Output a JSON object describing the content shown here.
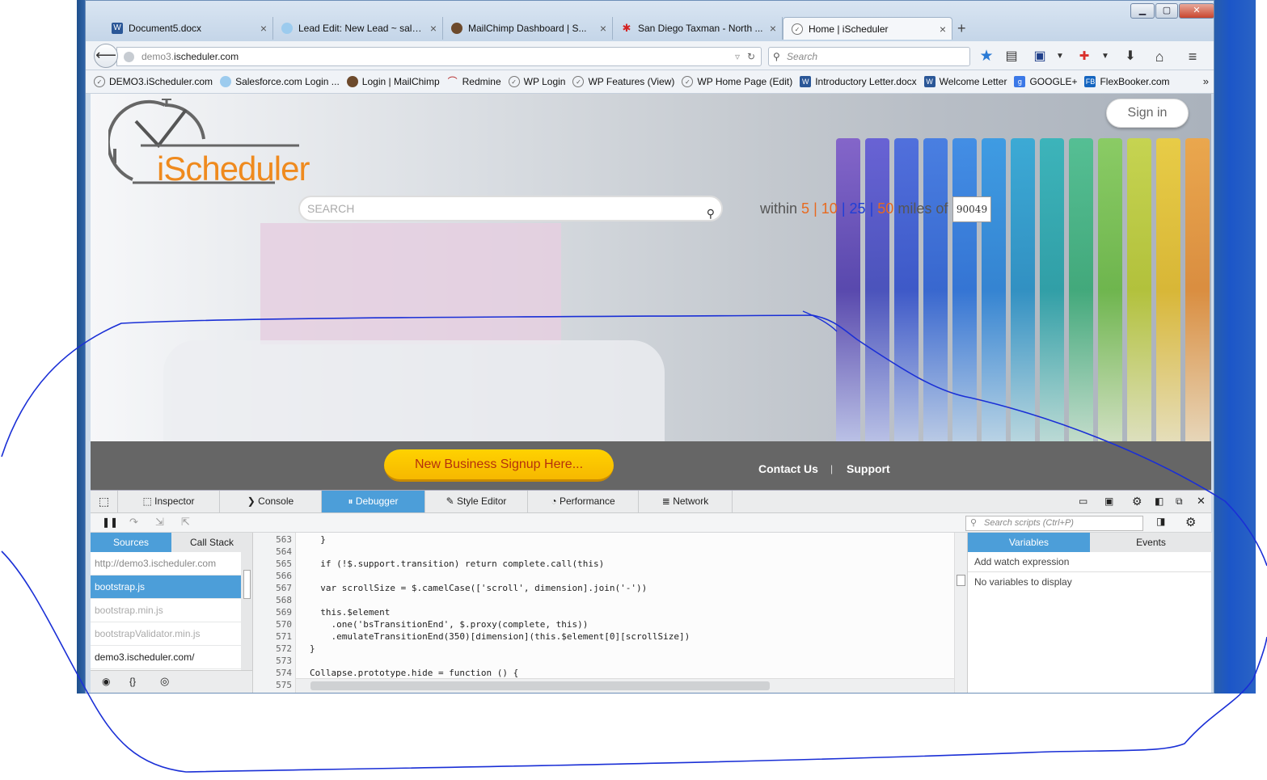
{
  "window": {
    "minimize": "▁",
    "maximize": "▢",
    "close": "✕"
  },
  "tabs": [
    {
      "label": "Document5.docx",
      "icon": "word-icon"
    },
    {
      "label": "Lead Edit: New Lead ~ sale...",
      "icon": "salesforce-icon"
    },
    {
      "label": "MailChimp Dashboard | S...",
      "icon": "mailchimp-icon"
    },
    {
      "label": "San Diego Taxman - North ...",
      "icon": "yelp-icon"
    },
    {
      "label": "Home | iScheduler",
      "icon": "clock-icon"
    }
  ],
  "new_tab": "+",
  "url": {
    "prefix": "demo3.",
    "domain": "ischeduler.com"
  },
  "search_placeholder": "Search",
  "bookmarks": [
    {
      "label": "DEMO3.iScheduler.com"
    },
    {
      "label": "Salesforce.com Login ..."
    },
    {
      "label": "Login | MailChimp"
    },
    {
      "label": "Redmine"
    },
    {
      "label": "WP Login"
    },
    {
      "label": "WP Features (View)"
    },
    {
      "label": "WP Home Page (Edit)"
    },
    {
      "label": "Introductory Letter.docx"
    },
    {
      "label": "Welcome Letter"
    },
    {
      "label": "GOOGLE+"
    },
    {
      "label": "FlexBooker.com"
    }
  ],
  "bookmarks_more": "»",
  "page": {
    "logo_text": "iScheduler",
    "sign_in": "Sign in",
    "search_placeholder": "SEARCH",
    "within": "within",
    "distances": [
      "5",
      "10",
      "25",
      "50"
    ],
    "distance_colors": [
      "#e8691e",
      "#e8691e",
      "#1f3fd6",
      "#e8691e"
    ],
    "separator": "|",
    "miles_of": "miles of",
    "zip": "90049",
    "signup": "New Business Signup Here...",
    "contact": "Contact Us",
    "footer_sep": "|",
    "support": "Support"
  },
  "devtools": {
    "tabs": [
      "Inspector",
      "Console",
      "Debugger",
      "Style Editor",
      "Performance",
      "Network"
    ],
    "active_tab": "Debugger",
    "script_search": "Search scripts (Ctrl+P)",
    "side_tabs": [
      "Sources",
      "Call Stack"
    ],
    "sources": [
      {
        "label": "http://demo3.ischeduler.com",
        "kind": "grp"
      },
      {
        "label": "bootstrap.js",
        "kind": "sel"
      },
      {
        "label": "bootstrap.min.js",
        "kind": "dim"
      },
      {
        "label": "bootstrapValidator.min.js",
        "kind": "dim"
      },
      {
        "label": "demo3.ischeduler.com/",
        "kind": "norm"
      }
    ],
    "line_numbers": [
      "563",
      "564",
      "565",
      "566",
      "567",
      "568",
      "569",
      "570",
      "571",
      "572",
      "573",
      "574",
      "575"
    ],
    "code": [
      "  }",
      "",
      "  if (!$.support.transition) return complete.call(this)",
      "",
      "  var scrollSize = $.camelCase(['scroll', dimension].join('-'))",
      "",
      "  this.$element",
      "    .one('bsTransitionEnd', $.proxy(complete, this))",
      "    .emulateTransitionEnd(350)[dimension](this.$element[0][scrollSize])",
      "}",
      "",
      "Collapse.prototype.hide = function () {",
      ""
    ],
    "var_tabs": [
      "Variables",
      "Events"
    ],
    "watch": "Add watch expression",
    "no_vars": "No variables to display"
  },
  "colors": {
    "accent": "#4c9ed9",
    "logo": "#ef8a1e",
    "ink": "#1a2fd6"
  }
}
